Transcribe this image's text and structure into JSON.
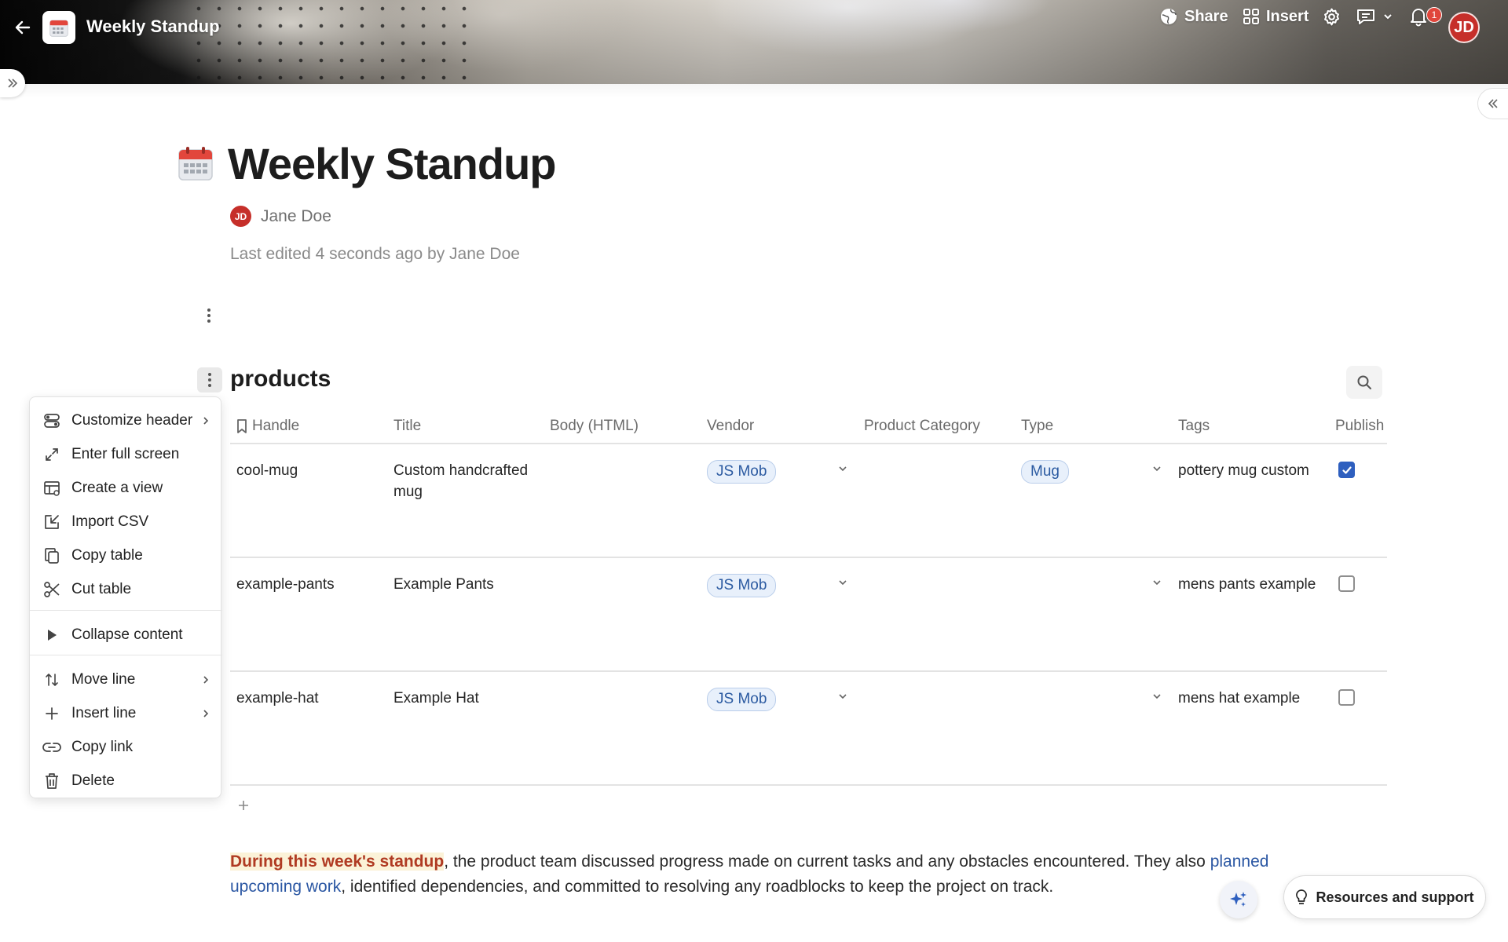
{
  "topbar": {
    "doc_title": "Weekly Standup",
    "actions": {
      "share_label": "Share",
      "insert_label": "Insert"
    },
    "notification_count": "1",
    "user_initials": "JD"
  },
  "page": {
    "title": "Weekly Standup",
    "author_initials": "JD",
    "author_name": "Jane Doe",
    "last_edited": "Last edited 4 seconds ago by Jane Doe"
  },
  "table": {
    "title": "products",
    "columns": [
      "Handle",
      "Title",
      "Body (HTML)",
      "Vendor",
      "Product Category",
      "Type",
      "Tags",
      "Publish"
    ],
    "rows": [
      {
        "handle": "cool-mug",
        "title": "Custom handcrafted mug",
        "body": "",
        "vendor": "JS Mob",
        "category": "",
        "type": "Mug",
        "tags": "pottery mug custom",
        "published": true
      },
      {
        "handle": "example-pants",
        "title": "Example Pants",
        "body": "",
        "vendor": "JS Mob",
        "category": "",
        "type": "",
        "tags": "mens pants example",
        "published": false
      },
      {
        "handle": "example-hat",
        "title": "Example Hat",
        "body": "",
        "vendor": "JS Mob",
        "category": "",
        "type": "",
        "tags": "mens hat example",
        "published": false
      }
    ]
  },
  "context_menu": {
    "items": [
      {
        "label": "Customize header",
        "icon": "toggle-icon",
        "submenu": true
      },
      {
        "label": "Enter full screen",
        "icon": "expand-icon",
        "submenu": false
      },
      {
        "label": "Create a view",
        "icon": "table-view-icon",
        "submenu": false
      },
      {
        "label": "Import CSV",
        "icon": "import-icon",
        "submenu": false
      },
      {
        "label": "Copy table",
        "icon": "copy-icon",
        "submenu": false
      },
      {
        "label": "Cut table",
        "icon": "scissors-icon",
        "submenu": false
      },
      {
        "label": "Collapse content",
        "icon": "triangle-right-icon",
        "submenu": false
      },
      {
        "label": "Move line",
        "icon": "move-arrows-icon",
        "submenu": true
      },
      {
        "label": "Insert line",
        "icon": "plus-icon",
        "submenu": true
      },
      {
        "label": "Copy link",
        "icon": "link-icon",
        "submenu": false
      },
      {
        "label": "Delete",
        "icon": "trash-icon",
        "submenu": false
      }
    ]
  },
  "paragraph": {
    "highlight": "During this week's standup",
    "text_1": ", the product team discussed progress made on current tasks and any obstacles encountered. They also ",
    "link": "planned upcoming work",
    "text_2": ", identified dependencies, and committed to resolving any roadblocks to keep the project on track."
  },
  "help_button": {
    "label": "Resources and support"
  },
  "colors": {
    "accent_red": "#c62f2a",
    "pill_blue": "#2b5aa1",
    "checkbox_blue": "#2e5fbf",
    "highlight_text": "#b03a22",
    "link_blue": "#2b57a3"
  }
}
